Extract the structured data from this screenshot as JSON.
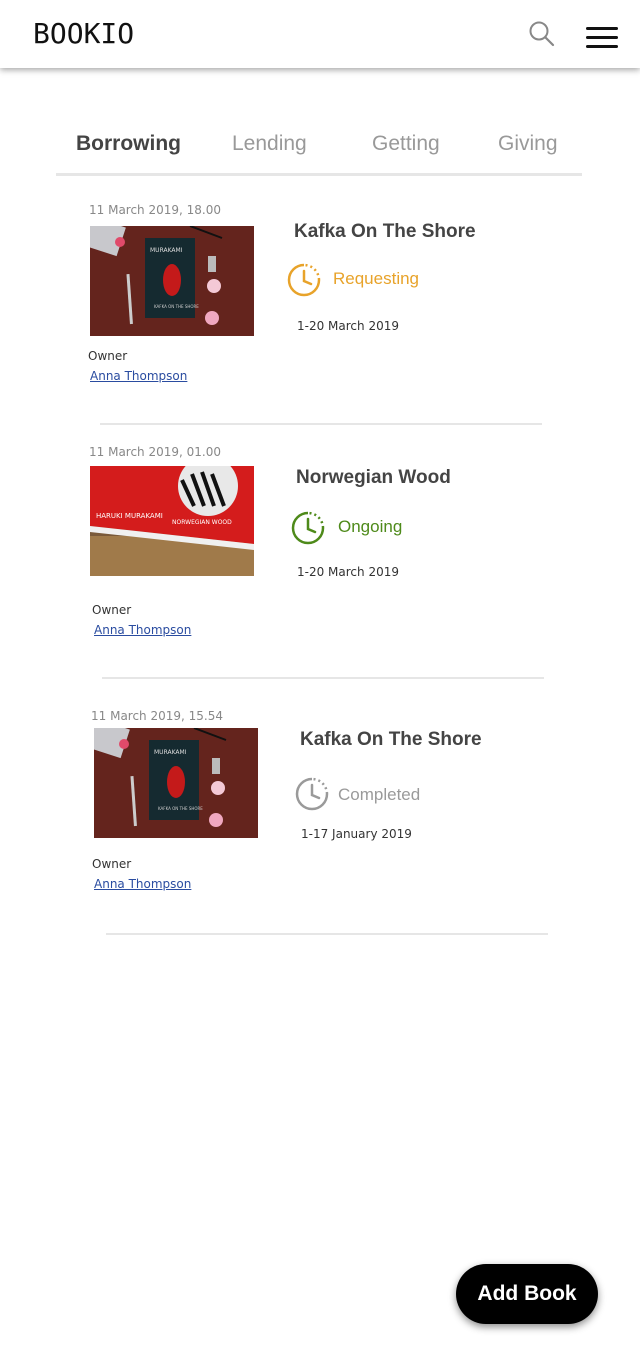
{
  "app": {
    "logo": "BOOKIO"
  },
  "header": {
    "search_icon": "search-icon",
    "menu_icon": "hamburger-menu-icon"
  },
  "tabs": [
    {
      "label": "Borrowing",
      "active": true
    },
    {
      "label": "Lending",
      "active": false
    },
    {
      "label": "Getting",
      "active": false
    },
    {
      "label": "Giving",
      "active": false
    }
  ],
  "items": [
    {
      "timestamp": "11 March 2019, 18.00",
      "title": "Kafka On The Shore",
      "status": "Requesting",
      "status_color": "#e8a32a",
      "dates": "1-20 March 2019",
      "owner_label": "Owner",
      "owner_name": "Anna Thompson",
      "cover": "kafka-cover-image"
    },
    {
      "timestamp": "11 March 2019, 01.00",
      "title": "Norwegian Wood",
      "status": "Ongoing",
      "status_color": "#4e8a1a",
      "dates": "1-20 March 2019",
      "owner_label": "Owner",
      "owner_name": "Anna Thompson",
      "cover": "norwegian-wood-cover-image"
    },
    {
      "timestamp": "11 March 2019, 15.54",
      "title": "Kafka On The Shore",
      "status": "Completed",
      "status_color": "#9a9a9a",
      "dates": "1-17 January 2019",
      "owner_label": "Owner",
      "owner_name": "Anna Thompson",
      "cover": "kafka-cover-image"
    }
  ],
  "add_button": {
    "label": "Add Book"
  }
}
